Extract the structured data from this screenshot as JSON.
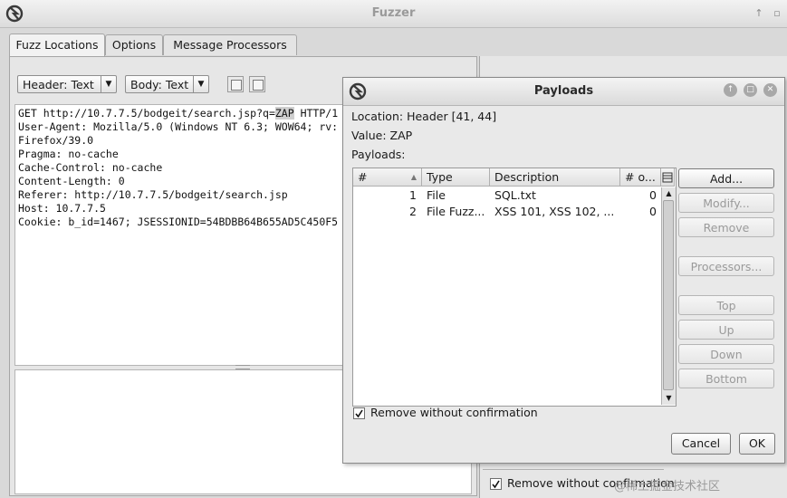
{
  "window": {
    "title": "Fuzzer",
    "logo_icon": "zap-logo-icon"
  },
  "tabs": [
    {
      "label": "Fuzz Locations",
      "active": true
    },
    {
      "label": "Options",
      "active": false
    },
    {
      "label": "Message Processors",
      "active": false
    }
  ],
  "left_panel": {
    "header_view": "Header: Text",
    "body_view": "Body: Text",
    "request_lines": [
      {
        "pre": "GET http://10.7.7.5/bodgeit/search.jsp?q=",
        "hl": "ZAP",
        "post": " HTTP/1"
      },
      {
        "pre": "User-Agent: Mozilla/5.0 (Windows NT 6.3; WOW64; rv:",
        "hl": "",
        "post": ""
      },
      {
        "pre": "Firefox/39.0",
        "hl": "",
        "post": ""
      },
      {
        "pre": "Pragma: no-cache",
        "hl": "",
        "post": ""
      },
      {
        "pre": "Cache-Control: no-cache",
        "hl": "",
        "post": ""
      },
      {
        "pre": "Content-Length: 0",
        "hl": "",
        "post": ""
      },
      {
        "pre": "Referer: http://10.7.7.5/bodgeit/search.jsp",
        "hl": "",
        "post": ""
      },
      {
        "pre": "Host: 10.7.7.5",
        "hl": "",
        "post": ""
      },
      {
        "pre": "Cookie: b_id=1467; JSESSIONID=54BDBB64B655AD5C450F5",
        "hl": "",
        "post": ""
      }
    ]
  },
  "background_panel": {
    "remove_without_confirmation": "Remove without confirmation"
  },
  "dialog": {
    "title": "Payloads",
    "location_label": "Location:",
    "location_value": "Header [41, 44]",
    "value_label": "Value:",
    "value_value": "ZAP",
    "payloads_label": "Payloads:",
    "columns": [
      "#",
      "Type",
      "Description",
      "# o..."
    ],
    "rows": [
      {
        "num": "1",
        "type": "File",
        "description": "SQL.txt",
        "count": "0"
      },
      {
        "num": "2",
        "type": "File Fuzz...",
        "description": "XSS 101, XSS 102, ...",
        "count": "0"
      }
    ],
    "buttons": {
      "add": "Add...",
      "modify": "Modify...",
      "remove": "Remove",
      "processors": "Processors...",
      "top": "Top",
      "up": "Up",
      "down": "Down",
      "bottom": "Bottom",
      "cancel": "Cancel",
      "ok": "OK"
    },
    "remove_without_confirmation": "Remove without confirmation"
  },
  "watermark": "@稀土掘金技术社区"
}
